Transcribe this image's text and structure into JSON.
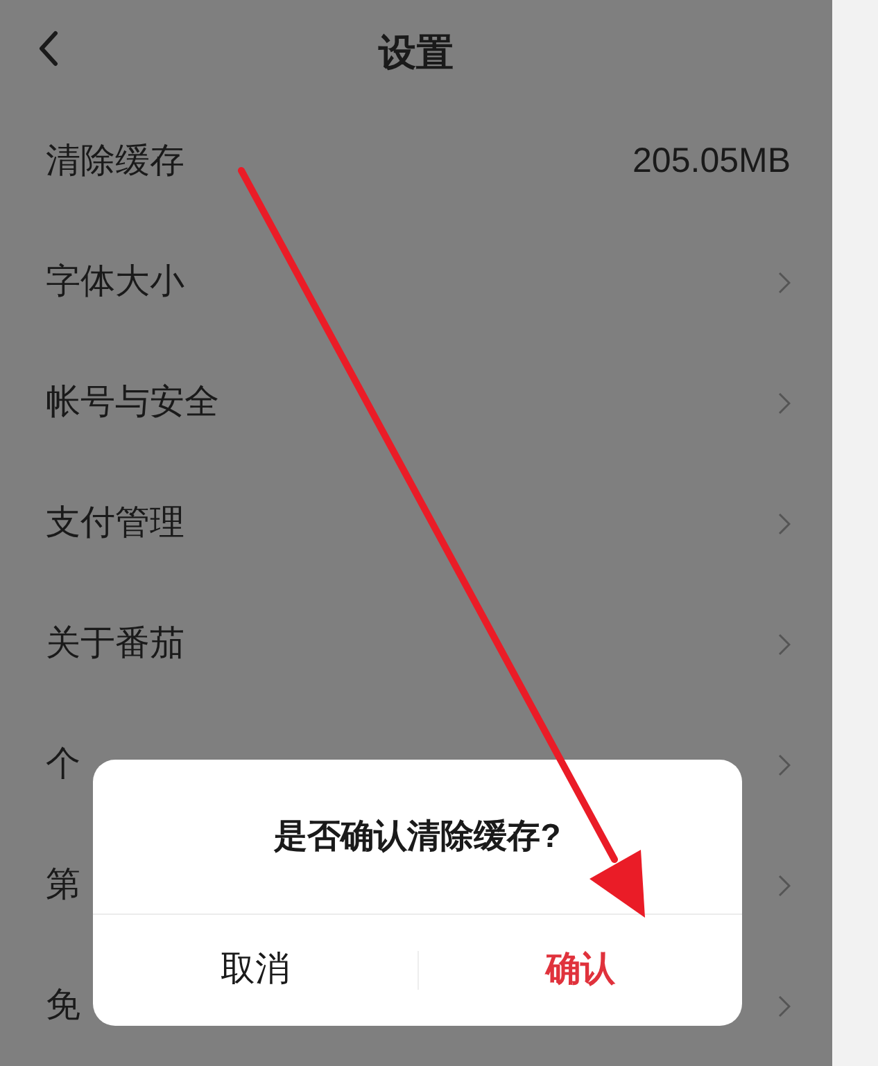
{
  "header": {
    "title": "设置"
  },
  "settings": [
    {
      "kind": "value",
      "label": "清除缓存",
      "value": "205.05MB"
    },
    {
      "kind": "link",
      "label": "字体大小"
    },
    {
      "kind": "link",
      "label": "帐号与安全"
    },
    {
      "kind": "link",
      "label": "支付管理"
    },
    {
      "kind": "link",
      "label": "关于番茄"
    },
    {
      "kind": "link",
      "label": "个"
    },
    {
      "kind": "link",
      "label": "第"
    },
    {
      "kind": "link",
      "label": "免"
    }
  ],
  "dialog": {
    "message": "是否确认清除缓存?",
    "buttons": [
      {
        "label": "取消",
        "kind": "cancel"
      },
      {
        "label": "确认",
        "kind": "confirm"
      }
    ]
  },
  "annotation": {
    "kind": "arrow",
    "color": "#ea1c27"
  }
}
